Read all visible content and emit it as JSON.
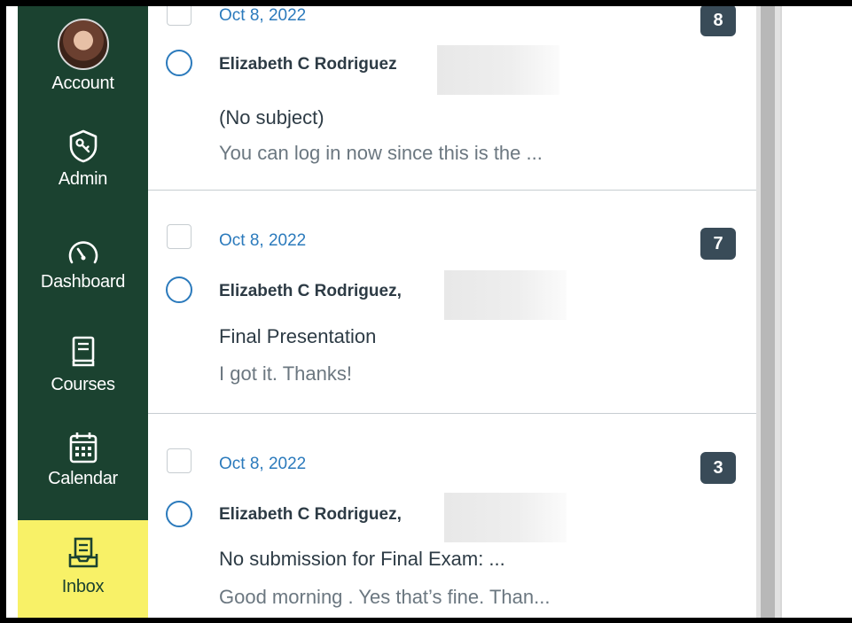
{
  "nav": {
    "account": "Account",
    "admin": "Admin",
    "dashboard": "Dashboard",
    "courses": "Courses",
    "calendar": "Calendar",
    "inbox": "Inbox"
  },
  "messages": [
    {
      "date": "Oct 8, 2022",
      "count": "8",
      "author": "Elizabeth C Rodriguez",
      "subject": "(No subject)",
      "preview": "You can log in now since this is the ..."
    },
    {
      "date": "Oct 8, 2022",
      "count": "7",
      "author": "Elizabeth C Rodriguez,",
      "subject": "Final Presentation",
      "preview": "I got it. Thanks!"
    },
    {
      "date": "Oct 8, 2022",
      "count": "3",
      "author": "Elizabeth C Rodriguez,",
      "subject": "No submission for Final Exam: ...",
      "preview": "Good morning . Yes that’s fine. Than..."
    }
  ],
  "colors": {
    "nav_bg": "#1b4230",
    "active_bg": "#f8f167",
    "link_blue": "#2b7abc",
    "badge": "#394b58"
  }
}
